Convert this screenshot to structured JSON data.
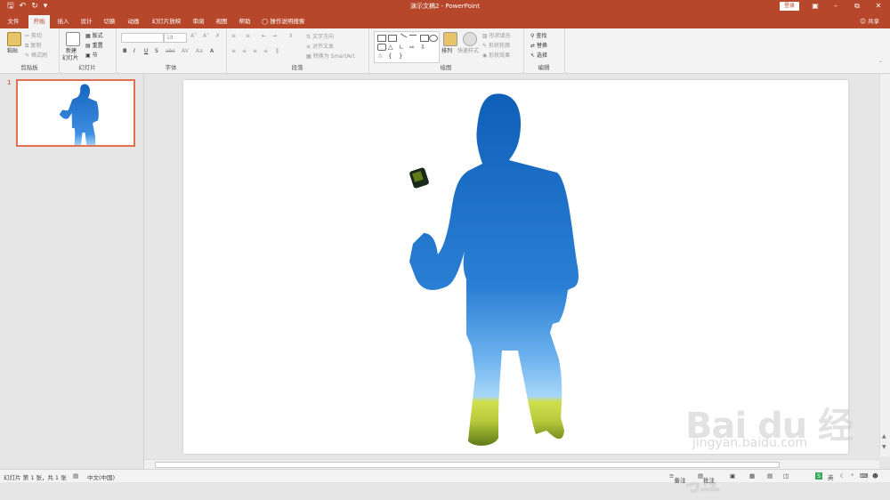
{
  "window": {
    "title": "演示文稿2  -  PowerPoint",
    "login_label": "登录"
  },
  "quick_access": [
    "save-icon",
    "undo-icon",
    "redo-icon",
    "customize-icon"
  ],
  "tabs": [
    {
      "label": "文件"
    },
    {
      "label": "开始"
    },
    {
      "label": "插入"
    },
    {
      "label": "设计"
    },
    {
      "label": "切换"
    },
    {
      "label": "动画"
    },
    {
      "label": "幻灯片放映"
    },
    {
      "label": "审阅"
    },
    {
      "label": "视图"
    },
    {
      "label": "帮助"
    }
  ],
  "tell_me": "操作说明搜索",
  "share_label": "共享",
  "ribbon": {
    "clipboard": {
      "label": "剪贴板",
      "paste": "粘贴",
      "cut": "剪切",
      "copy": "复制",
      "format_painter": "格式刷"
    },
    "slides": {
      "label": "幻灯片",
      "new_slide": "新建",
      "new_slide2": "幻灯片",
      "layout": "版式",
      "reset": "重置",
      "section": "节"
    },
    "font": {
      "label": "字体",
      "font_name": "",
      "font_size": "18"
    },
    "paragraph": {
      "label": "段落",
      "text_direction": "文字方向",
      "align_text": "对齐文本",
      "smartart": "转换为 SmartArt"
    },
    "drawing": {
      "label": "绘图",
      "arrange": "排列",
      "quick_styles": "快速样式",
      "fill": "形状填充",
      "outline": "形状轮廓",
      "effects": "形状效果"
    },
    "editing": {
      "label": "编辑",
      "find": "查找",
      "replace": "替换",
      "select": "选择"
    }
  },
  "thumbnail": {
    "number": "1"
  },
  "status": {
    "slide_info": "幻灯片 第 1 张，共 1 张",
    "language": "中文(中国)",
    "notes": "备注",
    "comments": "批注",
    "ime": "英"
  },
  "watermark": {
    "brand": "Bai du 经验",
    "url": "jingyan.baidu.com"
  },
  "colors": {
    "accent": "#b7472a",
    "figure_top": "#1565c0",
    "figure_bottom": "#90caf9",
    "grass": "#c8d84a"
  }
}
